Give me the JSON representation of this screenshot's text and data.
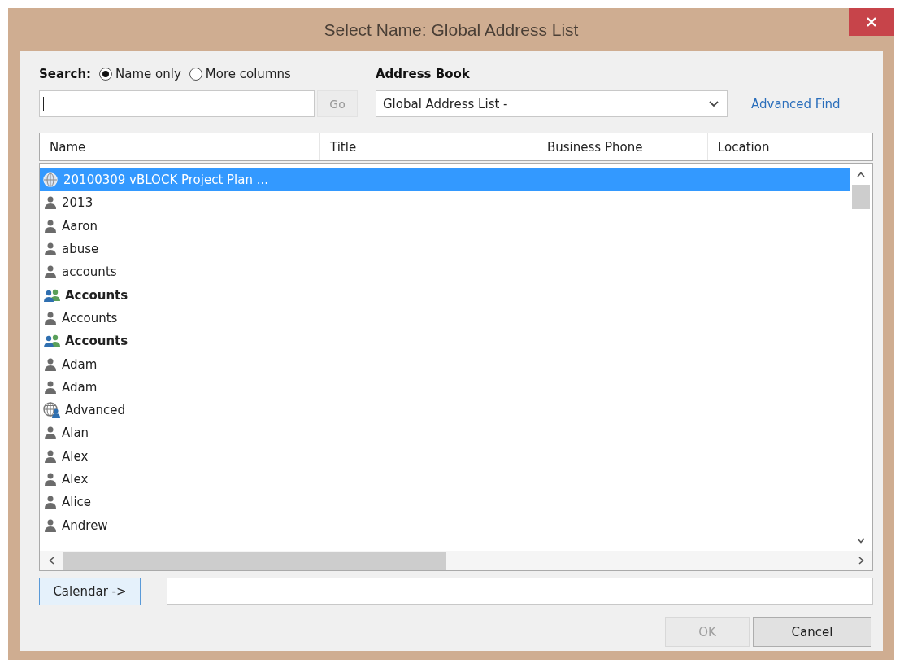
{
  "window": {
    "title": "Select Name: Global Address List"
  },
  "search": {
    "label": "Search:",
    "options": [
      {
        "label": "Name only",
        "selected": true
      },
      {
        "label": "More columns",
        "selected": false
      }
    ],
    "go": "Go"
  },
  "address_book": {
    "label": "Address Book",
    "value": "Global Address List -",
    "advanced_find": "Advanced Find"
  },
  "table": {
    "columns": [
      "Name",
      "Title",
      "Business Phone",
      "Location"
    ],
    "rows": [
      {
        "name": "20100309 vBLOCK Project Plan ...",
        "kind": "public-folder",
        "selected": true
      },
      {
        "name": "2013",
        "kind": "person",
        "selected": false
      },
      {
        "name": "Aaron",
        "kind": "person",
        "selected": false
      },
      {
        "name": "abuse",
        "kind": "person",
        "selected": false
      },
      {
        "name": "accounts",
        "kind": "person",
        "selected": false
      },
      {
        "name": "Accounts",
        "kind": "group",
        "selected": false
      },
      {
        "name": "Accounts",
        "kind": "person",
        "selected": false
      },
      {
        "name": "Accounts",
        "kind": "group",
        "selected": false
      },
      {
        "name": "Adam",
        "kind": "person",
        "selected": false
      },
      {
        "name": "Adam",
        "kind": "person",
        "selected": false
      },
      {
        "name": "Advanced",
        "kind": "external",
        "selected": false
      },
      {
        "name": "Alan",
        "kind": "person",
        "selected": false
      },
      {
        "name": "Alex",
        "kind": "person",
        "selected": false
      },
      {
        "name": "Alex",
        "kind": "person",
        "selected": false
      },
      {
        "name": "Alice",
        "kind": "person",
        "selected": false
      },
      {
        "name": "Andrew",
        "kind": "person",
        "selected": false
      }
    ]
  },
  "recipient": {
    "button": "Calendar ->"
  },
  "buttons": [
    {
      "label": "OK",
      "disabled": true
    },
    {
      "label": "Cancel",
      "disabled": false
    }
  ]
}
